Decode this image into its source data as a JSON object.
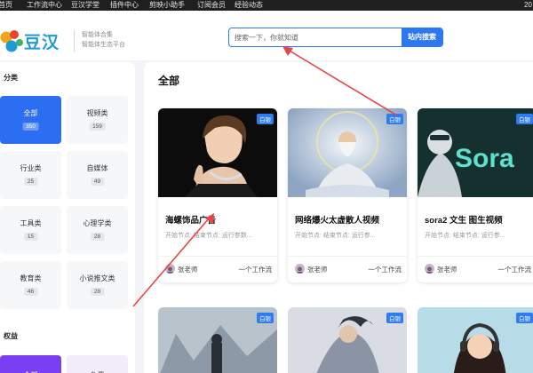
{
  "topnav": {
    "items": [
      "首页",
      "工作流中心",
      "豆汉学堂",
      "插件中心",
      "剪映小助手",
      "订阅会员",
      "经验动态"
    ],
    "right_text": "20"
  },
  "header": {
    "logo_text": "豆汉",
    "slogan_1": "智能体合集",
    "slogan_2": "智能体生态平台",
    "search": {
      "placeholder": "搜索一下，你就知道",
      "button": "站内搜索"
    }
  },
  "sidebar": {
    "category_title": "分类",
    "categories": [
      {
        "name": "全部",
        "count": "350",
        "active": true
      },
      {
        "name": "视频类",
        "count": "159"
      },
      {
        "name": "行业类",
        "count": "25"
      },
      {
        "name": "自媒体",
        "count": "49"
      },
      {
        "name": "工具类",
        "count": "15"
      },
      {
        "name": "心理学类",
        "count": "28"
      },
      {
        "name": "教育类",
        "count": "46"
      },
      {
        "name": "小说推文类",
        "count": "28"
      }
    ],
    "rights_title": "权益",
    "rights": [
      "全部",
      "免费"
    ]
  },
  "main": {
    "section_title": "全部",
    "cards": [
      {
        "badge": "白银",
        "title": "海螺饰品广告",
        "meta": "开始节点: 结束节点: 运行参数...",
        "author": "张老师",
        "flow": "一个工作流"
      },
      {
        "badge": "白银",
        "title": "网络爆火太虚散人视频",
        "meta": "开始节点: 结束节点: 运行参...",
        "author": "张老师",
        "flow": "一个工作流"
      },
      {
        "badge": "白银",
        "title": "sora2 文生 图生视频",
        "meta": "开始节点: 结束节点: 运行参...",
        "author": "张老师",
        "flow": "一个工作流"
      }
    ],
    "row2_badges": [
      "白银",
      "白银",
      "白银"
    ],
    "sora_text": "Sora"
  },
  "colors": {
    "accent": "#2b78f2",
    "badge": "#2f7cf1",
    "annotation": "#e84545"
  }
}
